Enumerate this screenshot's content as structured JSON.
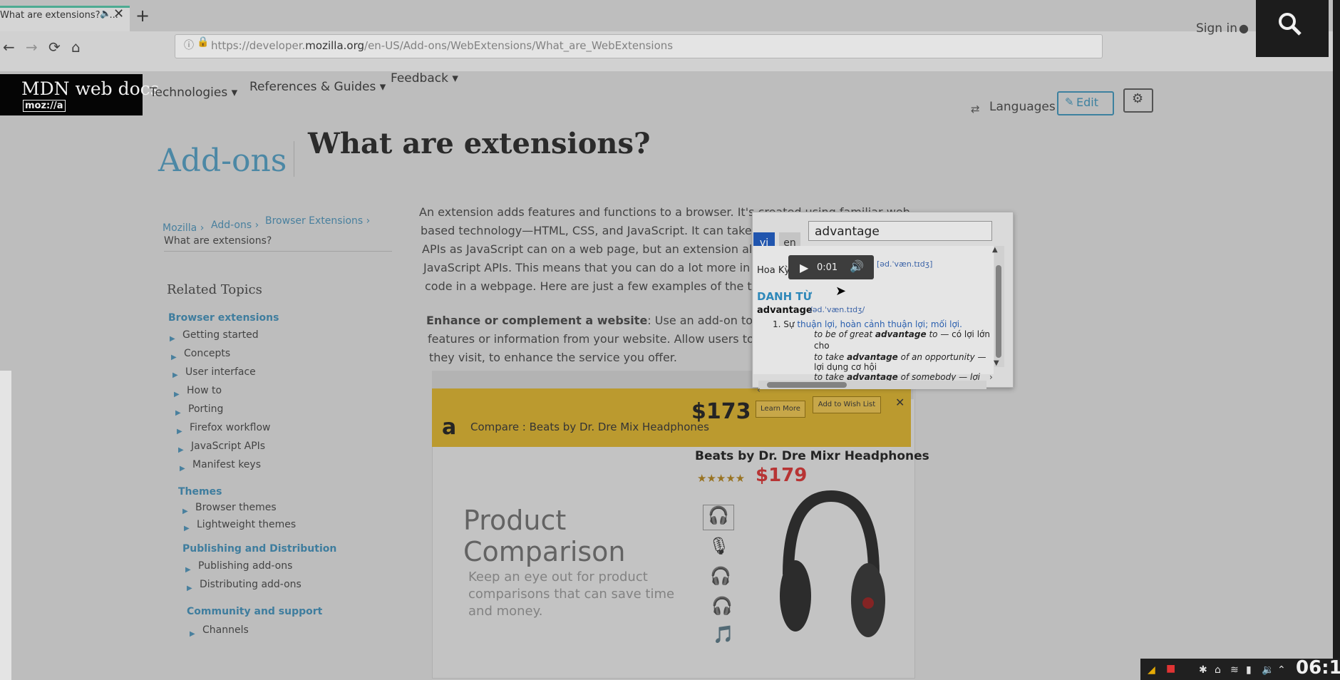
{
  "browser": {
    "tab_title": "What are extensions? - ...",
    "tab_audio_icon": "speaker-icon",
    "tab_close_icon": "close-icon",
    "new_tab_label": "+",
    "url_info_icon": "info-icon",
    "url_lock_icon": "lock-icon",
    "url_prefix": "https://developer.",
    "url_host": "mozilla.org",
    "url_path": "/en-US/Add-ons/WebExtensions/What_are_WebExtensions",
    "back_icon": "←",
    "forward_icon": "→",
    "reload_icon": "⟳",
    "home_icon": "⌂"
  },
  "header": {
    "logo_text": "MDN web docs",
    "logo_sub": "moz://a",
    "nav": [
      "Technologies ▾",
      "References & Guides ▾",
      "Feedback ▾"
    ],
    "signin": "Sign in",
    "languages": "Languages",
    "edit": "Edit"
  },
  "title": {
    "section": "Add-ons",
    "page": "What are extensions?"
  },
  "breadcrumbs": [
    "Mozilla ›",
    "Add-ons ›",
    "Browser Extensions ›"
  ],
  "breadcrumb_current": "What are extensions?",
  "sidebar": {
    "related": "Related Topics",
    "browser_extensions": "Browser extensions",
    "be_items": [
      "Getting started",
      "Concepts",
      "User interface",
      "How to",
      "Porting",
      "Firefox workflow",
      "JavaScript APIs",
      "Manifest keys"
    ],
    "themes": "Themes",
    "theme_items": [
      "Browser themes",
      "Lightweight themes"
    ],
    "publishing": "Publishing and Distribution",
    "pub_items": [
      "Publishing add-ons",
      "Distributing add-ons"
    ],
    "community": "Community and support",
    "community_items": [
      "Channels"
    ]
  },
  "article": {
    "p1": [
      "An extension adds features and functions to a browser. It's created using familiar web-",
      "based technology—HTML, CSS, and JavaScript. It can take advantage of the same web",
      "APIs as JavaScript can on a web page, but an extension also h",
      "JavaScript APIs. This means that you can do a lot more in an e",
      "code in a webpage. Here are just a few examples of the thing"
    ],
    "p2_bold": "Enhance or complement a website",
    "p2": [
      ": Use an add-on to deliver",
      "features or information from your website. Allow users to co",
      "they visit, to enhance the service you offer."
    ]
  },
  "screenshot": {
    "amazon_logo": "a",
    "compare_text": "Compare : Beats by Dr. Dre Mix Headphones",
    "compare_price": "$173",
    "learn_more": "Learn More",
    "wish_list": "Add to Wish List",
    "close": "✕",
    "product_title": "Beats by Dr. Dre Mixr Headphones",
    "stars": "★★★★★",
    "product_price": "$179",
    "pc_title_1": "Product",
    "pc_title_2": "Comparison",
    "pc_desc": [
      "Keep an eye out for product",
      "comparisons that can save time",
      "and money."
    ]
  },
  "dictionary": {
    "lang_vi": "vi",
    "lang_en": "en",
    "query": "advantage",
    "region": "Hoa Kỳ",
    "audio_time": "0:01",
    "phonetic": "[əd.ˈvæn.tɪdʒ]",
    "pos": "DANH TỪ",
    "headword": "advantage",
    "headword_phonetic": "/əd.ˈvæn.tɪdʒ/",
    "sense_number": "1.",
    "sense_prefix": "Sự",
    "synonyms": "thuận lợi, hoàn cảnh thuận lợi; mối lợi.",
    "ex1_pre": "to be of great",
    "ex1_bold": "advantage",
    "ex1_post": "to",
    "ex1_trans": "— có lợi lớn",
    "ex1_trans2": "cho",
    "ex2_pre": "to take",
    "ex2_bold": "advantage",
    "ex2_post": "of an opportunity —",
    "ex2_trans": "lợi dụng cơ hội",
    "ex3_pre": "to take",
    "ex3_bold": "advantage",
    "ex3_post": "of somebody — lợi"
  },
  "system": {
    "clock": "06:1"
  },
  "colors": {
    "mdn_blue": "#4e8fae",
    "dict_vi_active": "#1e57b8",
    "price_red": "#c23434",
    "amazon_yellow": "#c6a22e"
  }
}
